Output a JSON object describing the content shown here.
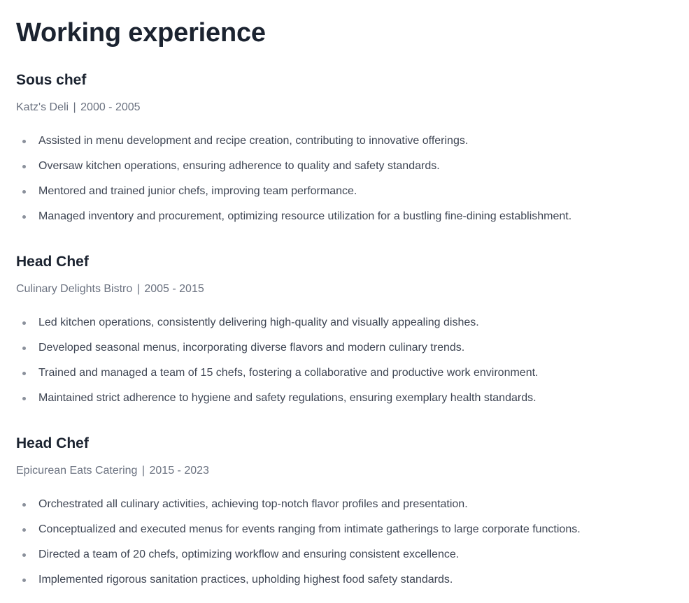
{
  "section": {
    "title": "Working experience"
  },
  "jobs": [
    {
      "title": "Sous chef",
      "company": "Katz's Deli",
      "separator": "|",
      "period": "2000 - 2005",
      "duties": [
        "Assisted in menu development and recipe creation, contributing to innovative offerings.",
        "Oversaw kitchen operations, ensuring adherence to quality and safety standards.",
        "Mentored and trained junior chefs, improving team performance.",
        "Managed inventory and procurement, optimizing resource utilization for a bustling fine-dining establishment."
      ]
    },
    {
      "title": "Head Chef",
      "company": "Culinary Delights Bistro",
      "separator": "|",
      "period": "2005 - 2015",
      "duties": [
        "Led kitchen operations, consistently delivering high-quality and visually appealing dishes.",
        "Developed seasonal menus, incorporating diverse flavors and modern culinary trends.",
        "Trained and managed a team of 15 chefs, fostering a collaborative and productive work environment.",
        "Maintained strict adherence to hygiene and safety regulations, ensuring exemplary health standards."
      ]
    },
    {
      "title": "Head Chef",
      "company": "Epicurean Eats Catering",
      "separator": "|",
      "period": "2015 - 2023",
      "duties": [
        "Orchestrated all culinary activities, achieving top-notch flavor profiles and presentation.",
        "Conceptualized and executed menus for events ranging from intimate gatherings to large corporate functions.",
        "Directed a team of 20 chefs, optimizing workflow and ensuring consistent excellence.",
        "Implemented rigorous sanitation practices, upholding highest food safety standards."
      ]
    }
  ]
}
